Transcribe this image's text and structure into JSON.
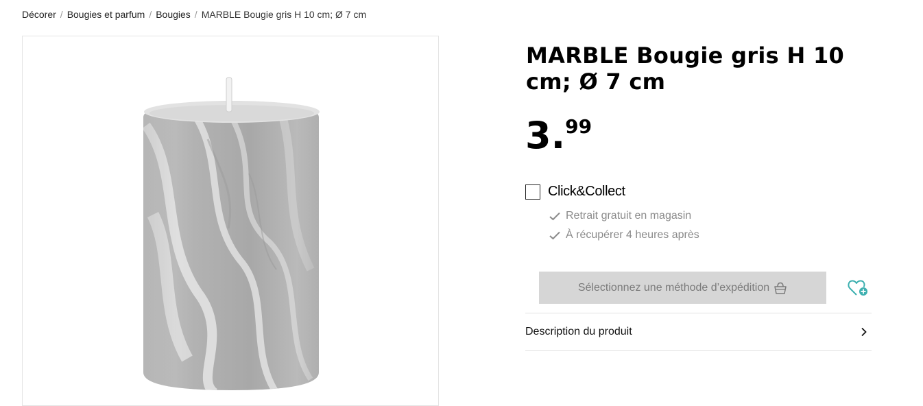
{
  "breadcrumb": {
    "items": [
      "Décorer",
      "Bougies et parfum",
      "Bougies"
    ],
    "current": "MARBLE Bougie gris H 10 cm; Ø 7 cm"
  },
  "product": {
    "title": "MARBLE Bougie gris H 10 cm; Ø 7 cm",
    "price_int": "3.",
    "price_dec": "99"
  },
  "click_collect": {
    "label": "Click&Collect",
    "checked": false,
    "features": [
      "Retrait gratuit en magasin",
      "À récupérer 4 heures après"
    ]
  },
  "shipping_button": {
    "label": "Sélectionnez une méthode d’expédition"
  },
  "description": {
    "label": "Description du produit"
  },
  "icons": {
    "check": "check-icon",
    "basket": "basket-icon",
    "wishlist": "heart-plus-icon",
    "chevron": "chevron-right-icon"
  },
  "colors": {
    "accent": "#3db0b0",
    "button_bg": "#d6d6d6",
    "button_text": "#7a7a7a",
    "muted_text": "#8a8a8a"
  }
}
